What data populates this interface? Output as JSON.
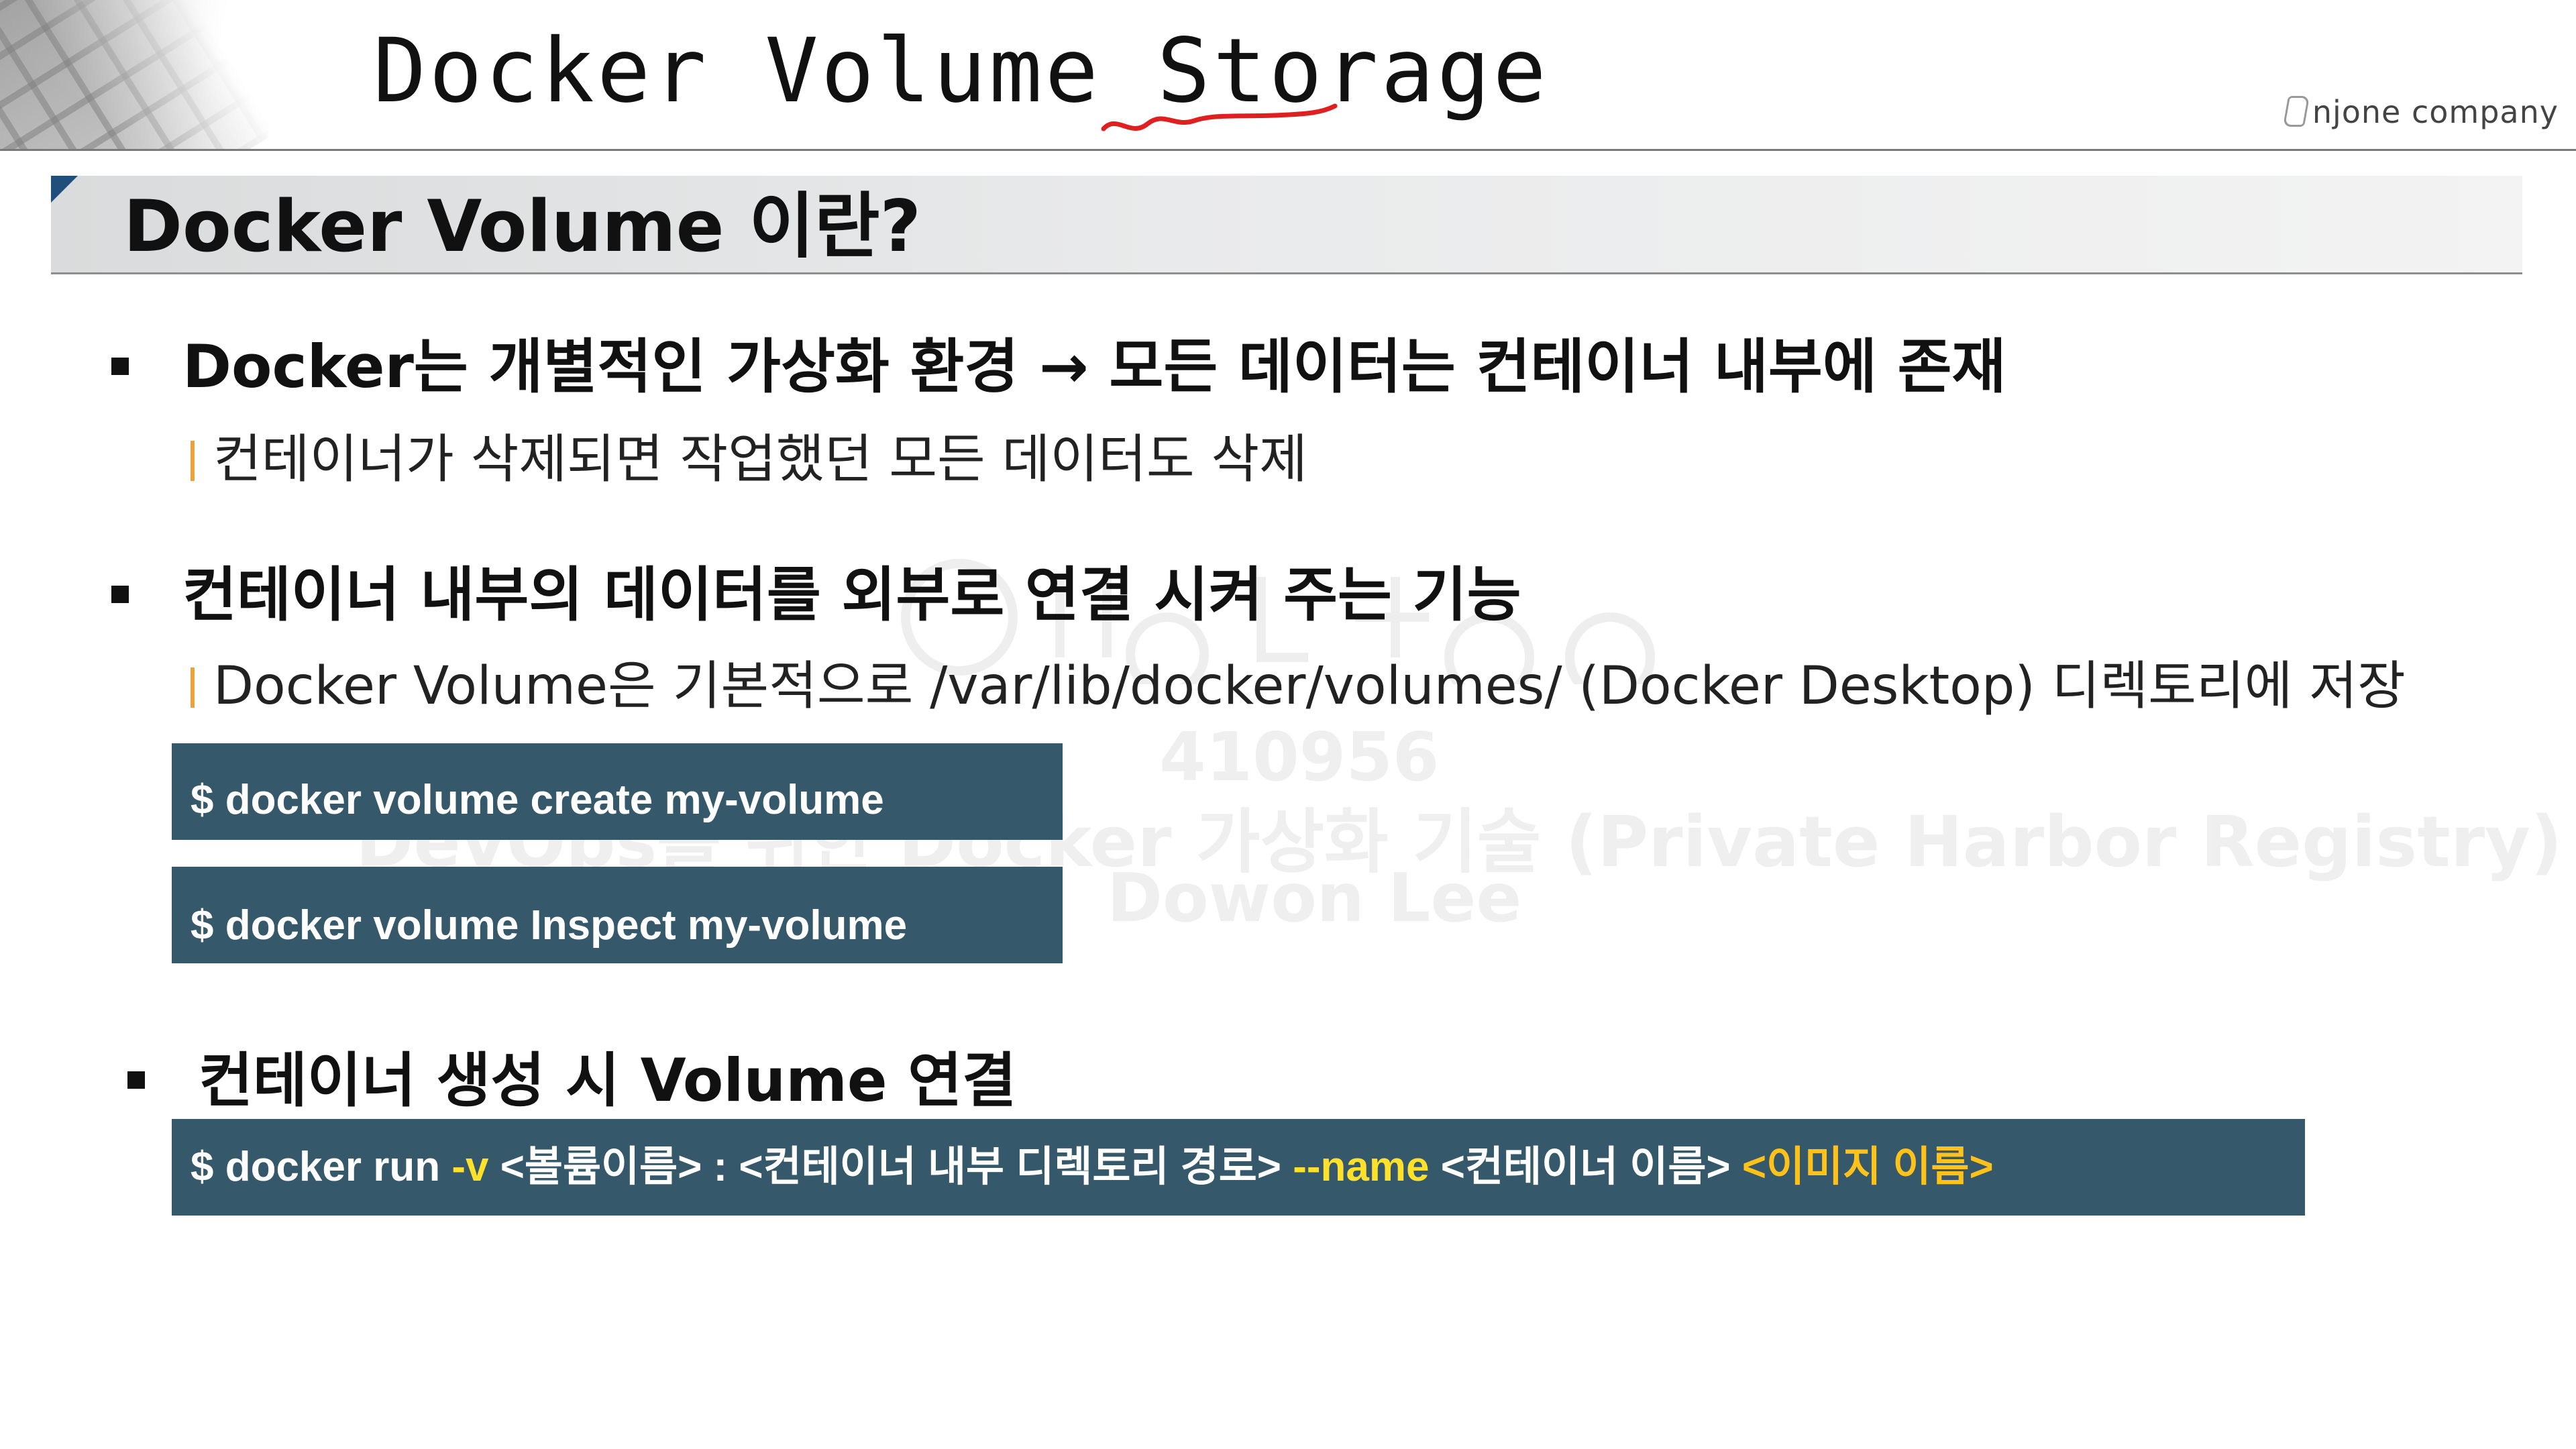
{
  "header": {
    "title": "Docker Volume Storage",
    "brand": "njone company"
  },
  "section": {
    "title": "Docker Volume 이란?"
  },
  "bullets": [
    {
      "text": "Docker는 개별적인 가상화 환경 → 모든 데이터는 컨테이너 내부에 존재",
      "sub": "컨테이너가 삭제되면 작업했던 모든 데이터도 삭제"
    },
    {
      "text": "컨테이너 내부의 데이터를 외부로 연결 시켜 주는 기능",
      "sub": "Docker Volume은 기본적으로 /var/lib/docker/volumes/ (Docker Desktop) 디렉토리에 저장"
    },
    {
      "text": "컨테이너 생성 시 Volume 연결"
    }
  ],
  "code": {
    "create": "$ docker volume create my-volume",
    "inspect": "$ docker volume Inspect my-volume",
    "run": {
      "prefix": "$ docker run ",
      "flag_v": "-v",
      "volume_part": " <볼륨이름> : <컨테이너 내부 디렉토리 경로> ",
      "flag_name": "--name",
      "name_part": " <컨테이너 이름> ",
      "image_part": "<이미지 이름>"
    }
  },
  "watermark": {
    "id": "410956",
    "course": "DevOps를 위한 Docker 가상화 기술 (Private Harbor Registry)",
    "author": "Dowon Lee"
  },
  "colors": {
    "code_bg": "#35586a",
    "accent_yellow": "#ffe12b",
    "accent_orange": "#ffc21a",
    "sub_bar": "#e8a33c",
    "corner": "#1f4f7a",
    "underline_red": "#e02020"
  }
}
